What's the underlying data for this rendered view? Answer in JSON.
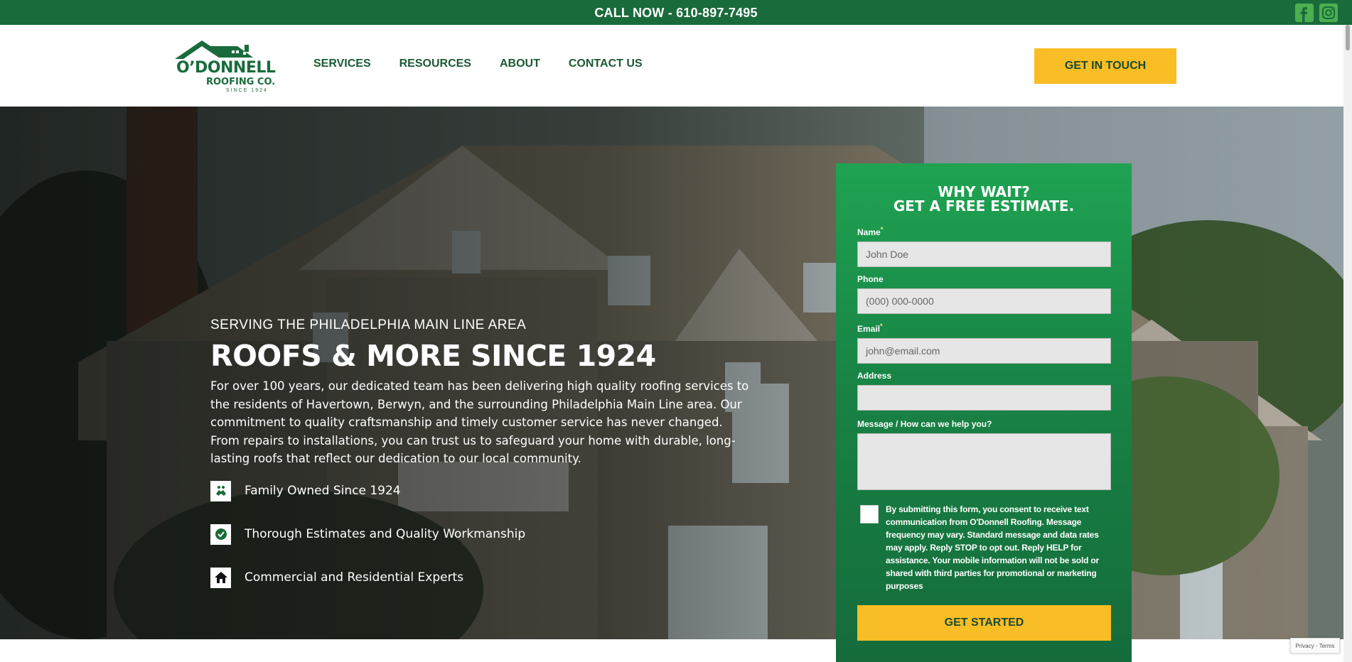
{
  "topbar": {
    "call_text": "CALL NOW - 610-897-7495",
    "social": [
      {
        "name": "facebook-icon",
        "color": "#4caf50"
      },
      {
        "name": "instagram-icon",
        "color": "#4caf50"
      }
    ]
  },
  "header": {
    "logo": {
      "line1": "O’DONNELL",
      "line2": "ROOFING CO.",
      "line3": "SINCE 1924"
    },
    "nav": [
      "SERVICES",
      "RESOURCES",
      "ABOUT",
      "CONTACT US"
    ],
    "cta": "GET IN TOUCH"
  },
  "hero": {
    "eyebrow": "SERVING THE PHILADELPHIA MAIN LINE AREA",
    "headline": "ROOFS & MORE SINCE 1924",
    "description": "For over 100 years, our dedicated team has been delivering high quality roofing services to the residents of Havertown, Berwyn, and the surrounding Philadelphia Main Line area. Our commitment to quality craftsmanship and timely customer service has never changed. From repairs to installations, you can trust us to safeguard your home with durable, long-lasting roofs that reflect our dedication to our local community.",
    "features": [
      {
        "icon": "handshake-icon",
        "label": "Family Owned Since 1924"
      },
      {
        "icon": "badge-check-icon",
        "label": "Thorough Estimates and Quality Workmanship"
      },
      {
        "icon": "house-icon",
        "label": "Commercial and Residential Experts"
      }
    ]
  },
  "form": {
    "title_line1": "WHY WAIT?",
    "title_line2": "GET A FREE ESTIMATE.",
    "fields": {
      "name": {
        "label": "Name",
        "required": "*",
        "placeholder": "John Doe"
      },
      "phone": {
        "label": "Phone",
        "placeholder": "(000) 000-0000"
      },
      "email": {
        "label": "Email",
        "required": "*",
        "placeholder": "john@email.com"
      },
      "address": {
        "label": "Address",
        "placeholder": ""
      },
      "message": {
        "label": "Message / How can we help you?",
        "placeholder": ""
      }
    },
    "consent": "By submitting this form, you consent to receive text communication from O'Donnell Roofing. Message frequency may vary. Standard message and data rates may apply. Reply STOP to opt out. Reply HELP for assistance. Your mobile information will not be sold or shared with third parties for promotional or marketing purposes",
    "submit": "GET STARTED"
  },
  "recaptcha": "Privacy - Terms",
  "colors": {
    "brand_green": "#1a6b3b",
    "accent_yellow": "#f9bd25"
  }
}
